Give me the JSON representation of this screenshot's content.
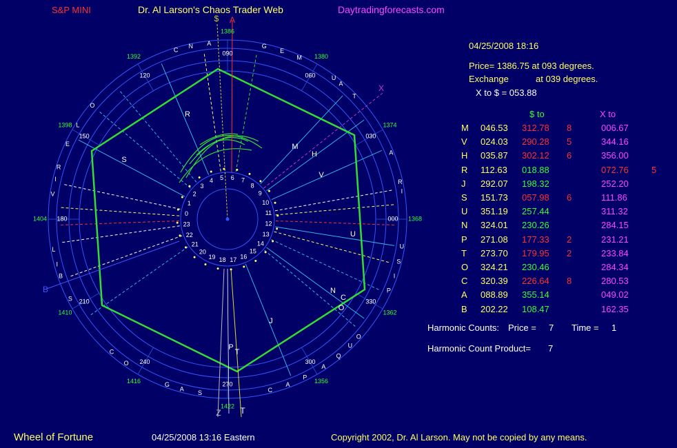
{
  "header": {
    "instrument": "S&P MINI",
    "title": "Dr. Al Larson's Chaos Trader Web",
    "site": "Daytradingforecasts.com"
  },
  "info": {
    "datetime": "04/25/2008 18:16",
    "price_line": "Price= 1386.75 at 093 degrees.",
    "exchange_label": "Exchange",
    "exchange_value": "at 039 degrees.",
    "x_to_dollar": "X to $  = 053.88"
  },
  "table": {
    "col_dollar": "$ to",
    "col_x": "X to",
    "rows": [
      {
        "sym": "M",
        "deg": "046.53",
        "dto": "312.78",
        "dto_color": "#ff3030",
        "h1": "8",
        "xto": "006.67",
        "h2": ""
      },
      {
        "sym": "V",
        "deg": "024.03",
        "dto": "290.28",
        "dto_color": "#ff3030",
        "h1": "5",
        "xto": "344.16",
        "h2": ""
      },
      {
        "sym": "H",
        "deg": "035.87",
        "dto": "302.12",
        "dto_color": "#ff3030",
        "h1": "6",
        "xto": "356.00",
        "h2": ""
      },
      {
        "sym": "R",
        "deg": "112.63",
        "dto": "018.88",
        "dto_color": "#33ff33",
        "h1": "",
        "xto": "072.76",
        "xto_color": "#ff3030",
        "h2": "5"
      },
      {
        "sym": "J",
        "deg": "292.07",
        "dto": "198.32",
        "dto_color": "#33ff33",
        "h1": "",
        "xto": "252.20",
        "h2": ""
      },
      {
        "sym": "S",
        "deg": "151.73",
        "dto": "057.98",
        "dto_color": "#ff3030",
        "h1": "6",
        "xto": "111.86",
        "h2": ""
      },
      {
        "sym": "U",
        "deg": "351.19",
        "dto": "257.44",
        "dto_color": "#33ff33",
        "h1": "",
        "xto": "311.32",
        "h2": ""
      },
      {
        "sym": "N",
        "deg": "324.01",
        "dto": "230.26",
        "dto_color": "#33ff33",
        "h1": "",
        "xto": "284.15",
        "h2": ""
      },
      {
        "sym": "P",
        "deg": "271.08",
        "dto": "177.33",
        "dto_color": "#ff3030",
        "h1": "2",
        "xto": "231.21",
        "h2": ""
      },
      {
        "sym": "T",
        "deg": "273.70",
        "dto": "179.95",
        "dto_color": "#ff3030",
        "h1": "2",
        "xto": "233.84",
        "h2": ""
      },
      {
        "sym": "O",
        "deg": "324.21",
        "dto": "230.46",
        "dto_color": "#33ff33",
        "h1": "",
        "xto": "284.34",
        "h2": ""
      },
      {
        "sym": "C",
        "deg": "320.39",
        "dto": "226.64",
        "dto_color": "#ff3030",
        "h1": "8",
        "xto": "280.53",
        "h2": ""
      },
      {
        "sym": "A",
        "deg": "088.89",
        "dto": "355.14",
        "dto_color": "#33ff33",
        "h1": "",
        "xto": "049.02",
        "h2": ""
      },
      {
        "sym": "B",
        "deg": "202.22",
        "dto": "108.47",
        "dto_color": "#33ff33",
        "h1": "",
        "xto": "162.35",
        "h2": ""
      }
    ]
  },
  "harmonics": {
    "counts_label": "Harmonic Counts:",
    "price_label": "Price =",
    "price_value": "7",
    "time_label": "Time =",
    "time_value": "1",
    "product_label": "Harmonic Count Product=",
    "product_value": "7"
  },
  "footer": {
    "name": "Wheel of Fortune",
    "datetime": "04/25/2008 13:16 Eastern",
    "copyright": "Copyright 2002, Dr. Al Larson. May not be copied by any means."
  },
  "wheel": {
    "degree_labels": [
      "000",
      "030",
      "060",
      "090",
      "120",
      "150",
      "180",
      "210",
      "240",
      "270",
      "300",
      "330"
    ],
    "price_labels": [
      "1368",
      "1374",
      "1380",
      "1386",
      "1392",
      "1398",
      "1404",
      "1410",
      "1416",
      "1422",
      "1356",
      "1362"
    ],
    "letters": [
      "G",
      "E",
      "M",
      "A",
      "N",
      "C",
      "O",
      "L",
      "E",
      "R",
      "I",
      "V",
      "L",
      "I",
      "B",
      "S",
      "C",
      "O",
      "S",
      "A",
      "G",
      "C",
      "A",
      "P",
      "A",
      "Q",
      "U",
      "O",
      "P",
      "I",
      "S",
      "U",
      "I",
      "R",
      "A",
      "T",
      "A",
      "U"
    ],
    "hour_labels": [
      "0",
      "1",
      "2",
      "3",
      "4",
      "5",
      "6",
      "7",
      "8",
      "9",
      "10",
      "11",
      "12",
      "13",
      "14",
      "15",
      "16",
      "17",
      "18",
      "19",
      "20",
      "21",
      "22",
      "23"
    ],
    "planet_labels": [
      "M",
      "H",
      "V",
      "U",
      "N",
      "O",
      "C",
      "J",
      "R",
      "S",
      "P",
      "T"
    ],
    "axis_labels": [
      "$",
      "A",
      "X",
      "B",
      "Z",
      "T"
    ],
    "colors": {
      "hexagon": "#33dd33",
      "planet_line": "#33b5e5",
      "axis_dollar": "#cccc33",
      "axis_x": "#cc33cc",
      "axis_a": "#ff3030",
      "arcs": "#33dd33"
    }
  }
}
